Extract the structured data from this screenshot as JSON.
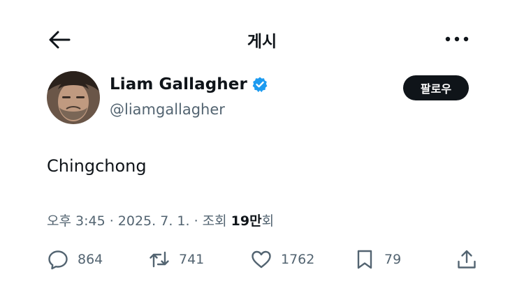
{
  "header": {
    "title": "게시"
  },
  "icons": {
    "back": "arrow-left-icon",
    "more": "more-horizontal-icon",
    "verified": "verified-badge-icon",
    "reply": "reply-icon",
    "retweet": "retweet-icon",
    "like": "heart-icon",
    "bookmark": "bookmark-icon",
    "share": "share-icon"
  },
  "author": {
    "display_name": "Liam Gallagher",
    "handle": "@liamgallagher",
    "follow_label": "팔로우"
  },
  "tweet": {
    "text": "Chingchong",
    "time": "오후 3:45",
    "sep": " · ",
    "date": "2025. 7. 1.",
    "views_label": "조회 ",
    "views_count": "19만",
    "views_suffix": "회"
  },
  "actions": {
    "replies": "864",
    "retweets": "741",
    "likes": "1762",
    "bookmarks": "79"
  },
  "colors": {
    "text": "#0f1419",
    "secondary": "#536471",
    "verified": "#1d9bf0",
    "follow_bg": "#0f1419"
  }
}
